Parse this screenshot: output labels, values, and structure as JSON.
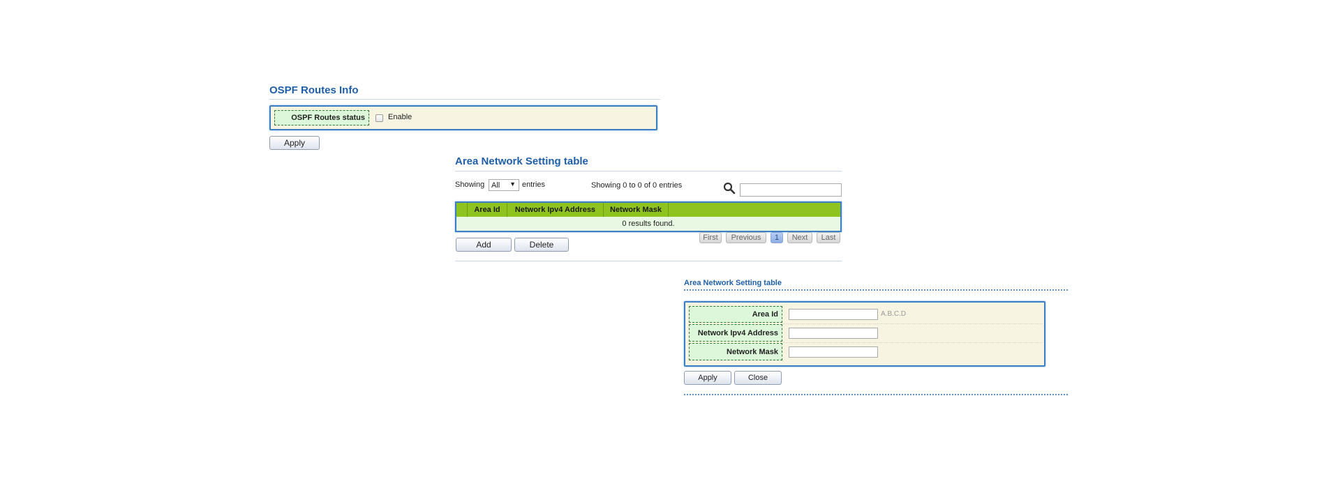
{
  "ospf": {
    "title": "OSPF Routes Info",
    "status_label": "OSPF Routes status",
    "enable_label": "Enable",
    "enable_checked": false,
    "apply_label": "Apply"
  },
  "area_table": {
    "title": "Area Network Setting table",
    "showing_label": "Showing",
    "page_size_value": "All",
    "entries_label": "entries",
    "summary": "Showing 0 to 0 of 0 entries",
    "search_value": "",
    "columns": [
      "Area Id",
      "Network Ipv4 Address",
      "Network Mask"
    ],
    "empty_message": "0 results found.",
    "pager": {
      "first": "First",
      "previous": "Previous",
      "current_page": "1",
      "next": "Next",
      "last": "Last"
    },
    "add_label": "Add",
    "delete_label": "Delete"
  },
  "area_form": {
    "title": "Area Network Setting table",
    "fields": [
      {
        "label": "Area Id",
        "value": "",
        "hint": "A.B.C.D"
      },
      {
        "label": "Network Ipv4 Address",
        "value": "",
        "hint": ""
      },
      {
        "label": "Network Mask",
        "value": "",
        "hint": ""
      }
    ],
    "apply_label": "Apply",
    "close_label": "Close"
  },
  "colors": {
    "title_blue": "#1f5fa8",
    "header_green": "#8fc31f",
    "label_green": "#dcf7d9",
    "panel_cream": "#f7f4e2",
    "panel_border": "#3d7fc4"
  }
}
